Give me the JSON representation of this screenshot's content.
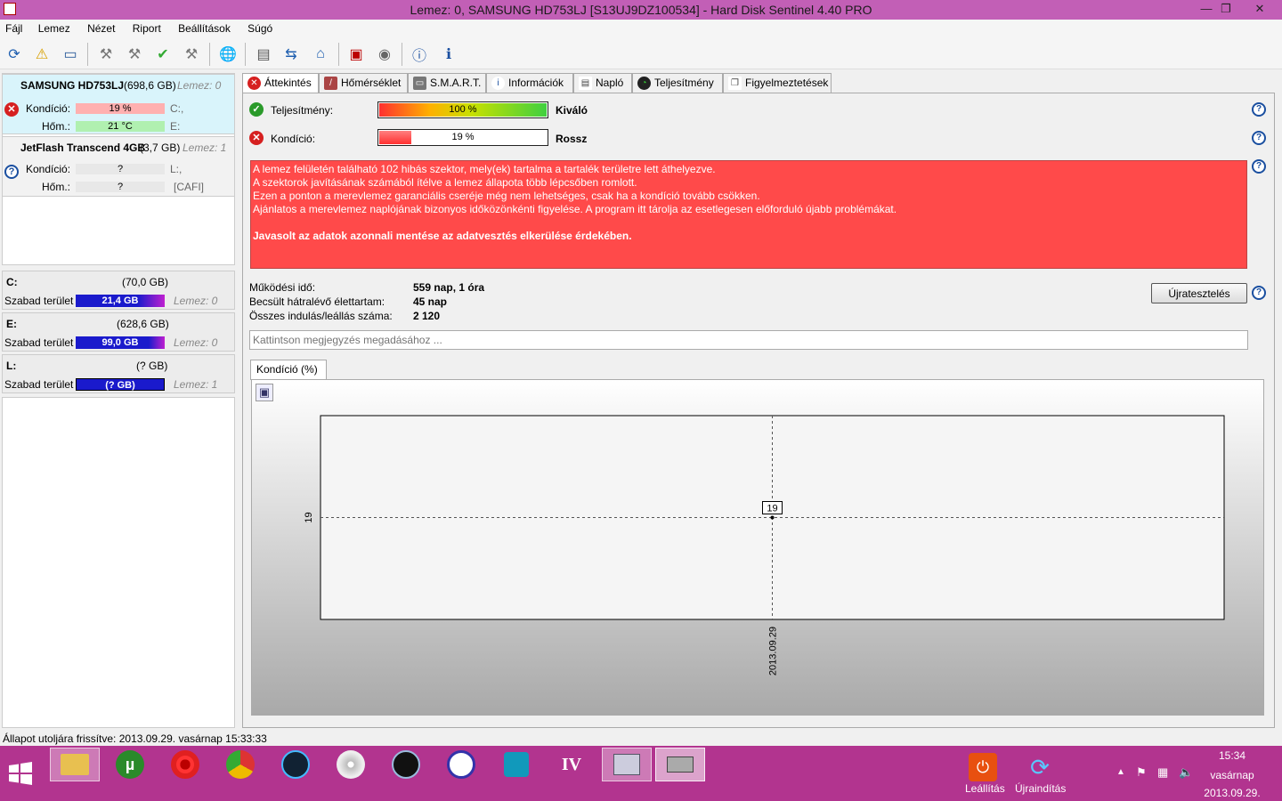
{
  "window": {
    "title": "Lemez: 0, SAMSUNG HD753LJ [S13UJ9DZ100534]  -  Hard Disk Sentinel 4.40 PRO"
  },
  "menu": [
    "Fájl",
    "Lemez",
    "Nézet",
    "Riport",
    "Beállítások",
    "Súgó"
  ],
  "disks": [
    {
      "name": "SAMSUNG HD753LJ",
      "size": "(698,6 GB)",
      "lemez": "Lemez: 0",
      "kondicio_label": "Kondíció:",
      "kondicio": "19 %",
      "kondicio_fraction": 0.19,
      "hom_label": "Hőm.:",
      "hom": "21 °C",
      "drive1": "C:,",
      "drive2": "E:"
    },
    {
      "name": "JetFlash Transcend 4GB",
      "size": "(3,7 GB)",
      "lemez": "Lemez: 1",
      "kondicio_label": "Kondíció:",
      "kondicio": "?",
      "hom_label": "Hőm.:",
      "hom": "?",
      "drive1": "L:,",
      "drive2": "[CAFI]"
    }
  ],
  "volumes": [
    {
      "letter": "C:",
      "size": "(70,0 GB)",
      "free_label": "Szabad terület",
      "free": "21,4 GB",
      "lemez": "Lemez: 0"
    },
    {
      "letter": "E:",
      "size": "(628,6 GB)",
      "free_label": "Szabad terület",
      "free": "99,0 GB",
      "lemez": "Lemez: 0"
    },
    {
      "letter": "L:",
      "size": "(? GB)",
      "free_label": "Szabad terület",
      "free": "(? GB)",
      "lemez": "Lemez: 1"
    }
  ],
  "tabs": [
    "Áttekintés",
    "Hőmérséklet",
    "S.M.A.R.T.",
    "Információk",
    "Napló",
    "Teljesítmény",
    "Figyelmeztetések"
  ],
  "overview": {
    "perf_label": "Teljesítmény:",
    "perf_value": "100 %",
    "perf_fraction": 1.0,
    "perf_text": "Kiváló",
    "cond_label": "Kondíció:",
    "cond_value": "19 %",
    "cond_fraction": 0.19,
    "cond_text": "Rossz",
    "alert_lines": [
      "A lemez felületén található 102 hibás szektor, mely(ek) tartalma a tartalék területre lett áthelyezve.",
      "A szektorok javításának számából ítélve a lemez állapota több lépcsőben romlott.",
      "Ezen a ponton a merevlemez garanciális cseréje még nem lehetséges, csak ha a kondíció tovább csökken.",
      "Ajánlatos a merevlemez naplójának bizonyos időközönkénti figyelése. A program itt tárolja az esetlegesen előforduló újabb problémákat."
    ],
    "alert_bold": "Javasolt az adatok azonnali mentése az adatvesztés elkerülése érdekében.",
    "uptime_label": "Működési idő:",
    "uptime": "559 nap, 1 óra",
    "life_label": "Becsült hátralévő élettartam:",
    "life": "45 nap",
    "starts_label": "Összes indulás/leállás száma:",
    "starts": "2 120",
    "retest_button": "Újratesztelés",
    "note_placeholder": "Kattintson megjegyzés megadásához ...",
    "chart_tab": "Kondíció  (%)"
  },
  "chart_data": {
    "type": "line",
    "x": [
      "2013.09.29"
    ],
    "y": [
      19
    ],
    "ytick_labels": [
      "19"
    ],
    "xtick_labels": [
      "2013.09.29"
    ],
    "data_labels": [
      "19"
    ],
    "ylim": [
      0,
      38
    ]
  },
  "status": {
    "text": "Állapot utoljára frissítve: 2013.09.29. vasárnap 15:33:33"
  },
  "taskbar": {
    "shutdown_label": "Leállítás",
    "restart_label": "Újraindítás",
    "time": "15:34",
    "day": "vasárnap",
    "date": "2013.09.29."
  },
  "colors": {
    "title": "#c25fb6",
    "taskbar": "#b2348f",
    "alert": "#ff4a4a",
    "good": "#5cd15c",
    "bad": "#ff5555",
    "free": "#1a1acc"
  }
}
